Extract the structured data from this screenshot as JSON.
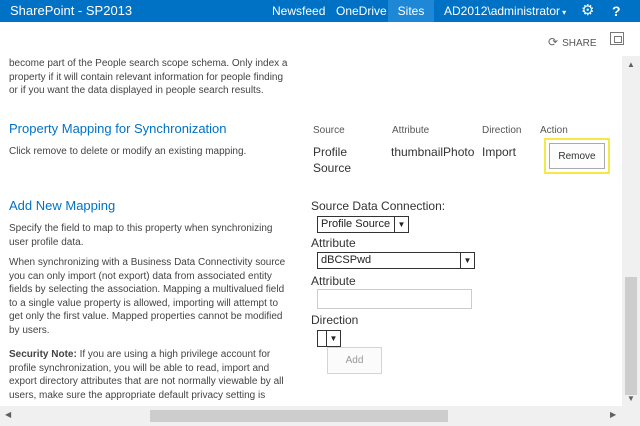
{
  "suite_bar": {
    "title": "SharePoint - SP2013",
    "nav": [
      "Newsfeed",
      "OneDrive",
      "Sites"
    ],
    "user": "AD2012\\administrator",
    "user_caret": "▾",
    "gear_icon": "⚙",
    "help_icon": "?",
    "bg_color": "#0072c6"
  },
  "ribbon": {
    "share_label": "SHARE",
    "share_icon": "⟳"
  },
  "intro_text": [
    "become part of the People search scope schema. Only index a",
    "property if it will contain relevant information for people finding",
    "or if you want the data displayed in people search results."
  ],
  "property_mapping": {
    "heading": "Property Mapping for Synchronization",
    "description": "Click remove to delete or modify an existing mapping.",
    "columns": [
      "Source",
      "Attribute",
      "Direction",
      "Action"
    ],
    "row": {
      "source_line1": "Profile",
      "source_line2": "Source",
      "attribute": "thumbnailPhoto",
      "direction": "Import",
      "action_label": "Remove"
    }
  },
  "add_mapping": {
    "heading": "Add New Mapping",
    "para1": [
      "Specify the field to map to this property when synchronizing",
      "user profile data."
    ],
    "para2": [
      "When synchronizing with a Business Data Connectivity source",
      "you can only import (not export) data from associated entity",
      "fields by selecting  the association. Mapping a multivalued field",
      "to a single value property is allowed, importing will attempt to",
      "get only the first value. Mapped properties cannot be modified",
      "by users."
    ],
    "security_label": "Security Note:",
    "security_first": " If you are using a high privilege account for",
    "security_rest": [
      "profile synchronization, you will be able to read, import and",
      "export directory attributes that are not normally viewable by all",
      "users, make sure the appropriate default privacy setting is"
    ],
    "source_connection_label": "Source Data Connection:",
    "source_connection_value": "Profile Source",
    "attribute_label": "Attribute",
    "attribute_value": "dBCSPwd",
    "attribute_text_label": "Attribute",
    "attribute_text_value": "",
    "direction_label": "Direction",
    "direction_value": "",
    "add_label": "Add"
  },
  "accent_colors": {
    "heading": "#0072c6",
    "highlight": "#f5e94a"
  }
}
